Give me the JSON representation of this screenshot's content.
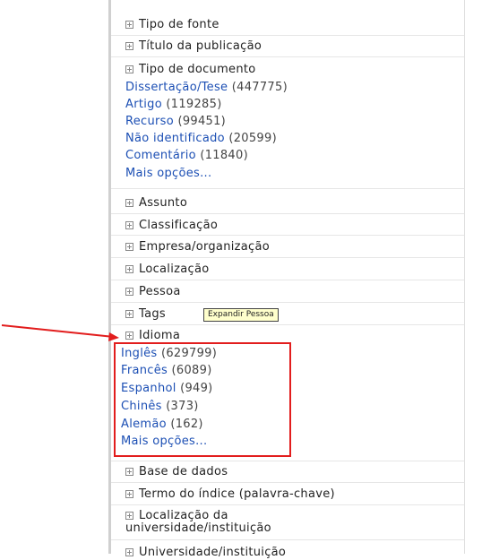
{
  "facets_top": [
    {
      "label": "Tipo de fonte"
    },
    {
      "label": "Título da publicação"
    }
  ],
  "document_type": {
    "label": "Tipo de documento",
    "items": [
      {
        "name": "Dissertação/Tese",
        "count": "(447775)"
      },
      {
        "name": "Artigo",
        "count": "(119285)"
      },
      {
        "name": "Recurso",
        "count": "(99451)"
      },
      {
        "name": "Não identificado",
        "count": "(20599)"
      },
      {
        "name": "Comentário",
        "count": "(11840)"
      }
    ],
    "more": "Mais opções..."
  },
  "facets_mid": [
    {
      "label": "Assunto"
    },
    {
      "label": "Classificação"
    },
    {
      "label": "Empresa/organização"
    },
    {
      "label": "Localização"
    },
    {
      "label": "Pessoa"
    },
    {
      "label": "Tags"
    }
  ],
  "tooltip": "Expandir Pessoa",
  "language": {
    "label": "Idioma",
    "items": [
      {
        "name": "Inglês",
        "count": "(629799)"
      },
      {
        "name": "Francês",
        "count": "(6089)"
      },
      {
        "name": "Espanhol",
        "count": "(949)"
      },
      {
        "name": "Chinês",
        "count": "(373)"
      },
      {
        "name": "Alemão",
        "count": "(162)"
      }
    ],
    "more": "Mais opções..."
  },
  "facets_bottom": [
    {
      "label": "Base de dados"
    },
    {
      "label": "Termo do índice (palavra-chave)"
    },
    {
      "label": "Localização da\nuniversidade/instituição"
    },
    {
      "label": "Universidade/instituição"
    }
  ],
  "colors": {
    "link": "#1c4fb4",
    "highlight": "#e21d1d",
    "tooltip_bg": "#ffffcc"
  }
}
